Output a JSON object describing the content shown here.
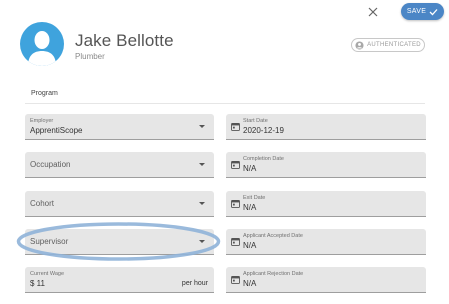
{
  "header": {
    "name": "Jake Bellotte",
    "role": "Plumber",
    "save_label": "SAVE",
    "auth_label": "AUTHENTICATED",
    "icons": {
      "avatar": "person-silhouette-icon",
      "close": "close-icon",
      "save": "check-icon",
      "auth": "account-circle-icon"
    }
  },
  "section": {
    "program_label": "Program"
  },
  "left_fields": {
    "employer": {
      "label": "Employer",
      "value": "ApprentiScope"
    },
    "occupation": {
      "placeholder": "Occupation"
    },
    "cohort": {
      "placeholder": "Cohort"
    },
    "supervisor": {
      "placeholder": "Supervisor"
    },
    "wage": {
      "label": "Current Wage",
      "value": "$ 11",
      "suffix": "per hour"
    }
  },
  "right_fields": {
    "start_date": {
      "label": "Start Date",
      "value": "2020-12-19"
    },
    "completion_date": {
      "label": "Completion Date",
      "value": "N/A"
    },
    "exit_date": {
      "label": "Exit Date",
      "value": "N/A"
    },
    "accepted_date": {
      "label": "Applicant Accepted Date",
      "value": "N/A"
    },
    "rejection_date": {
      "label": "Applicant Rejection Date",
      "value": "N/A"
    }
  },
  "colors": {
    "accent": "#4b86c6",
    "avatar": "#3fa3dd",
    "highlight": "#8fb2d8",
    "field_bg": "#e6e6e6"
  }
}
